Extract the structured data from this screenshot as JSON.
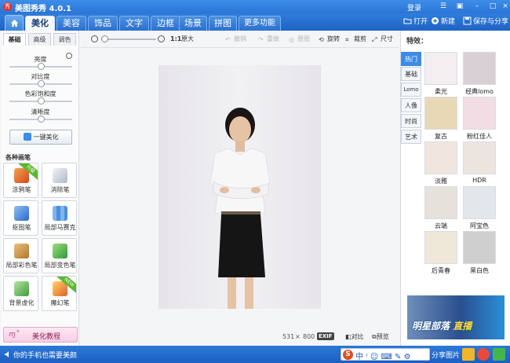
{
  "app": {
    "title": "美图秀秀 4.0.1",
    "logo": "秀",
    "login": "登录"
  },
  "menu": {
    "tabs": [
      "美化",
      "美容",
      "饰品",
      "文字",
      "边框",
      "场景",
      "拼图",
      "更多功能"
    ],
    "more_arrow": "▾",
    "open": "打开",
    "new": "新建",
    "save_share": "保存与分享"
  },
  "left_panel": {
    "tabs": [
      "基础",
      "高级",
      "调色"
    ],
    "adjustments": [
      {
        "label": "亮度",
        "value": 0.5
      },
      {
        "label": "对比度",
        "value": 0.5
      },
      {
        "label": "色彩饱和度",
        "value": 0.5
      },
      {
        "label": "清晰度",
        "value": 0.5
      }
    ],
    "one_key_button": "一键美化",
    "brushes_title": "各种画笔",
    "tools": [
      {
        "label": "涂鸦笔",
        "ribbon": "升级",
        "color": "#e56b2c"
      },
      {
        "label": "消除笔",
        "ribbon": "",
        "color": "#b9c3cf"
      },
      {
        "label": "抠图笔",
        "ribbon": "",
        "color": "#3b7fd6"
      },
      {
        "label": "局部马赛克",
        "ribbon": "",
        "color": "#6aa7e8"
      },
      {
        "label": "局部彩色笔",
        "ribbon": "",
        "color": "#c9964a"
      },
      {
        "label": "局部变色笔",
        "ribbon": "",
        "color": "#4cae4c"
      },
      {
        "label": "背景虚化",
        "ribbon": "",
        "color": "#5bb15b"
      },
      {
        "label": "魔幻笔",
        "ribbon": "NEW",
        "color": "#e0772d"
      }
    ],
    "tutorial": {
      "icon_text": "ɱ˚",
      "label": "美化教程"
    }
  },
  "center_toolbar": {
    "ratio": "1:1",
    "original_size": "原大",
    "undo": "撤销",
    "redo": "重做",
    "original": "原图",
    "rotate": "旋转",
    "crop": "裁剪",
    "size": "尺寸",
    "zoom_level": 0.0
  },
  "canvas_status": {
    "width": "531",
    "times": "×",
    "height": "800",
    "exif": "EXIF",
    "compare": "对比",
    "preview": "预览"
  },
  "right_panel": {
    "title": "特效：",
    "categories": [
      "热门",
      "基础",
      "Lomo",
      "人像",
      "时尚",
      "艺术"
    ],
    "effects": [
      {
        "label": "柔光",
        "tone": "#f3eef0"
      },
      {
        "label": "经典lomo",
        "tone": "#d9d0d6"
      },
      {
        "label": "复古",
        "tone": "#e9d8b5"
      },
      {
        "label": "粉红佳人",
        "tone": "#f3dde5"
      },
      {
        "label": "淡雅",
        "tone": "#f0e6df"
      },
      {
        "label": "HDR",
        "tone": "#ece4df"
      },
      {
        "label": "云端",
        "tone": "#e6e1da"
      },
      {
        "label": "阿宝色",
        "tone": "#e3e6ea"
      },
      {
        "label": "后青春",
        "tone": "#efe7d7"
      },
      {
        "label": "黑白色",
        "tone": "#cfcfcf"
      }
    ],
    "ad": {
      "text1": "明星部落",
      "text2": "直播"
    }
  },
  "status_bar": {
    "text": "你的手机也需要美颜",
    "share": "分享图片"
  },
  "colors": {
    "accent": "#2a74d6",
    "active_tab_bg": "#f4f7fb"
  }
}
